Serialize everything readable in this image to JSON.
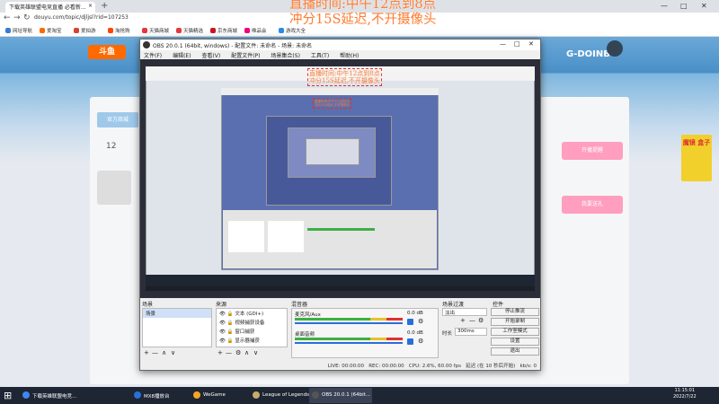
{
  "browser": {
    "tab_title": "下载英雄联盟电竞直播 必看新...",
    "tab_close": "×",
    "new_tab": "+",
    "url": "douyu.com/topic/djljsl?rid=107253",
    "min": "—",
    "max": "□",
    "close": "✕",
    "back": "←",
    "forward": "→",
    "reload": "↻",
    "bookmarks": [
      {
        "label": "网址导航",
        "color": "#3a7bd5"
      },
      {
        "label": "爱淘宝",
        "color": "#ff6a00"
      },
      {
        "label": "爱拍游",
        "color": "#d9432f"
      },
      {
        "label": "淘抢购",
        "color": "#ff4400"
      },
      {
        "label": "天猫商城",
        "color": "#e4393c"
      },
      {
        "label": "天猫精选",
        "color": "#e4393c"
      },
      {
        "label": "京东商城",
        "color": "#c91623"
      },
      {
        "label": "唯品会",
        "color": "#f10180"
      },
      {
        "label": "游戏大全",
        "color": "#2b8ae6"
      }
    ]
  },
  "overlay": {
    "line1": "直播时间:中午12点到8点",
    "line2": "冲分15S延迟,不开摄像头"
  },
  "site": {
    "logo": "斗鱼",
    "banner_text": "G-DOINB",
    "tab_official": "官方商城",
    "count": "12",
    "right_buttons": [
      "开播提醒",
      "我要送礼"
    ],
    "promo_title": "魔镜 盒子"
  },
  "obs": {
    "title": "OBS 20.0.1 (64bit, windows) - 配置文件: 未命名 - 场景: 未命名",
    "menu": [
      "文件(F)",
      "编辑(E)",
      "查看(V)",
      "配置文件(P)",
      "场景集合(S)",
      "工具(T)",
      "帮助(H)"
    ],
    "docks": {
      "scenes": {
        "title": "场景",
        "items": [
          "场景"
        ]
      },
      "sources": {
        "title": "来源",
        "items": [
          "文本 (GDI+)",
          "视频捕获设备",
          "窗口捕获",
          "显示器捕获"
        ]
      },
      "mixer": {
        "title": "混音器",
        "channels": [
          {
            "label": "麦克风/Aux",
            "db": "0.0 dB"
          },
          {
            "label": "桌面音频",
            "db": "0.0 dB"
          }
        ]
      },
      "transitions": {
        "title": "场景过渡",
        "selected": "淡出",
        "duration_label": "时长",
        "duration": "300ms"
      },
      "controls": {
        "title": "控件",
        "buttons": [
          "停止推流",
          "开始录制",
          "工作室模式",
          "设置",
          "退出"
        ]
      }
    },
    "status": {
      "live": "LIVE: 00:00:00",
      "rec": "REC: 00:00:00",
      "cpu": "CPU: 2.6%, 60.00 fps",
      "delay": "延迟 (在 10 秒后开始) ",
      "kbps": "kb/s: 0"
    },
    "add": "+",
    "remove": "—",
    "up": "∧",
    "down": "∨",
    "gear": "⚙"
  },
  "taskbar": {
    "start": "⊞",
    "items": [
      {
        "label": "下载英雄联盟电竞...",
        "color": "#4285f4"
      },
      {
        "label": "MX8播放台",
        "color": "#2a6edb"
      },
      {
        "label": "WeGame",
        "color": "#f5a623"
      },
      {
        "label": "League of Legends",
        "color": "#c8aa6e"
      },
      {
        "label": "OBS 20.0.1 (64bit...",
        "color": "#555"
      }
    ],
    "time": "11:15:01",
    "date": "2022/7/22"
  }
}
